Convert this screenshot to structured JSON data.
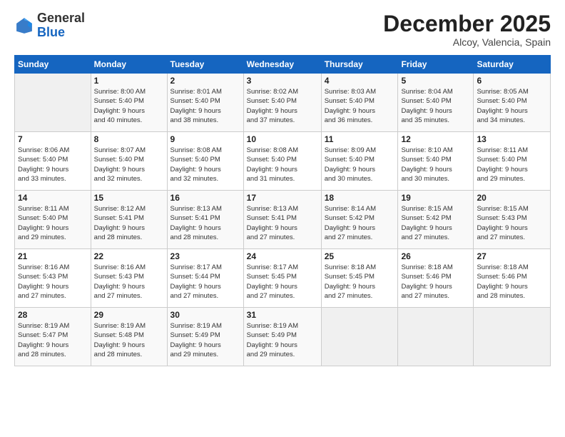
{
  "header": {
    "logo_general": "General",
    "logo_blue": "Blue",
    "month": "December 2025",
    "location": "Alcoy, Valencia, Spain"
  },
  "weekdays": [
    "Sunday",
    "Monday",
    "Tuesday",
    "Wednesday",
    "Thursday",
    "Friday",
    "Saturday"
  ],
  "weeks": [
    [
      {
        "day": "",
        "info": ""
      },
      {
        "day": "1",
        "info": "Sunrise: 8:00 AM\nSunset: 5:40 PM\nDaylight: 9 hours\nand 40 minutes."
      },
      {
        "day": "2",
        "info": "Sunrise: 8:01 AM\nSunset: 5:40 PM\nDaylight: 9 hours\nand 38 minutes."
      },
      {
        "day": "3",
        "info": "Sunrise: 8:02 AM\nSunset: 5:40 PM\nDaylight: 9 hours\nand 37 minutes."
      },
      {
        "day": "4",
        "info": "Sunrise: 8:03 AM\nSunset: 5:40 PM\nDaylight: 9 hours\nand 36 minutes."
      },
      {
        "day": "5",
        "info": "Sunrise: 8:04 AM\nSunset: 5:40 PM\nDaylight: 9 hours\nand 35 minutes."
      },
      {
        "day": "6",
        "info": "Sunrise: 8:05 AM\nSunset: 5:40 PM\nDaylight: 9 hours\nand 34 minutes."
      }
    ],
    [
      {
        "day": "7",
        "info": "Sunrise: 8:06 AM\nSunset: 5:40 PM\nDaylight: 9 hours\nand 33 minutes."
      },
      {
        "day": "8",
        "info": "Sunrise: 8:07 AM\nSunset: 5:40 PM\nDaylight: 9 hours\nand 32 minutes."
      },
      {
        "day": "9",
        "info": "Sunrise: 8:08 AM\nSunset: 5:40 PM\nDaylight: 9 hours\nand 32 minutes."
      },
      {
        "day": "10",
        "info": "Sunrise: 8:08 AM\nSunset: 5:40 PM\nDaylight: 9 hours\nand 31 minutes."
      },
      {
        "day": "11",
        "info": "Sunrise: 8:09 AM\nSunset: 5:40 PM\nDaylight: 9 hours\nand 30 minutes."
      },
      {
        "day": "12",
        "info": "Sunrise: 8:10 AM\nSunset: 5:40 PM\nDaylight: 9 hours\nand 30 minutes."
      },
      {
        "day": "13",
        "info": "Sunrise: 8:11 AM\nSunset: 5:40 PM\nDaylight: 9 hours\nand 29 minutes."
      }
    ],
    [
      {
        "day": "14",
        "info": "Sunrise: 8:11 AM\nSunset: 5:40 PM\nDaylight: 9 hours\nand 29 minutes."
      },
      {
        "day": "15",
        "info": "Sunrise: 8:12 AM\nSunset: 5:41 PM\nDaylight: 9 hours\nand 28 minutes."
      },
      {
        "day": "16",
        "info": "Sunrise: 8:13 AM\nSunset: 5:41 PM\nDaylight: 9 hours\nand 28 minutes."
      },
      {
        "day": "17",
        "info": "Sunrise: 8:13 AM\nSunset: 5:41 PM\nDaylight: 9 hours\nand 27 minutes."
      },
      {
        "day": "18",
        "info": "Sunrise: 8:14 AM\nSunset: 5:42 PM\nDaylight: 9 hours\nand 27 minutes."
      },
      {
        "day": "19",
        "info": "Sunrise: 8:15 AM\nSunset: 5:42 PM\nDaylight: 9 hours\nand 27 minutes."
      },
      {
        "day": "20",
        "info": "Sunrise: 8:15 AM\nSunset: 5:43 PM\nDaylight: 9 hours\nand 27 minutes."
      }
    ],
    [
      {
        "day": "21",
        "info": "Sunrise: 8:16 AM\nSunset: 5:43 PM\nDaylight: 9 hours\nand 27 minutes."
      },
      {
        "day": "22",
        "info": "Sunrise: 8:16 AM\nSunset: 5:43 PM\nDaylight: 9 hours\nand 27 minutes."
      },
      {
        "day": "23",
        "info": "Sunrise: 8:17 AM\nSunset: 5:44 PM\nDaylight: 9 hours\nand 27 minutes."
      },
      {
        "day": "24",
        "info": "Sunrise: 8:17 AM\nSunset: 5:45 PM\nDaylight: 9 hours\nand 27 minutes."
      },
      {
        "day": "25",
        "info": "Sunrise: 8:18 AM\nSunset: 5:45 PM\nDaylight: 9 hours\nand 27 minutes."
      },
      {
        "day": "26",
        "info": "Sunrise: 8:18 AM\nSunset: 5:46 PM\nDaylight: 9 hours\nand 27 minutes."
      },
      {
        "day": "27",
        "info": "Sunrise: 8:18 AM\nSunset: 5:46 PM\nDaylight: 9 hours\nand 28 minutes."
      }
    ],
    [
      {
        "day": "28",
        "info": "Sunrise: 8:19 AM\nSunset: 5:47 PM\nDaylight: 9 hours\nand 28 minutes."
      },
      {
        "day": "29",
        "info": "Sunrise: 8:19 AM\nSunset: 5:48 PM\nDaylight: 9 hours\nand 28 minutes."
      },
      {
        "day": "30",
        "info": "Sunrise: 8:19 AM\nSunset: 5:49 PM\nDaylight: 9 hours\nand 29 minutes."
      },
      {
        "day": "31",
        "info": "Sunrise: 8:19 AM\nSunset: 5:49 PM\nDaylight: 9 hours\nand 29 minutes."
      },
      {
        "day": "",
        "info": ""
      },
      {
        "day": "",
        "info": ""
      },
      {
        "day": "",
        "info": ""
      }
    ]
  ]
}
